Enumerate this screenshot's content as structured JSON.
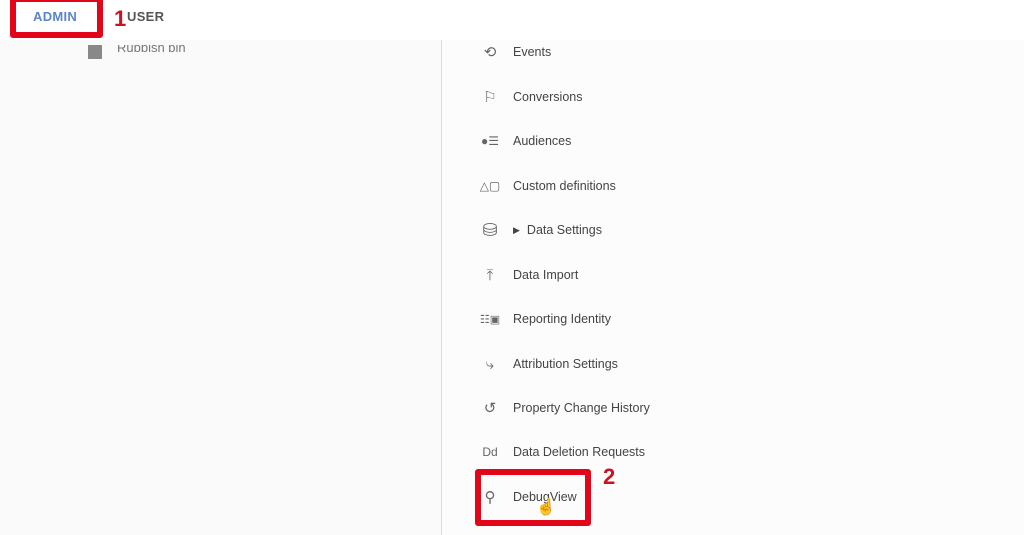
{
  "tabs": [
    {
      "label": "ADMIN",
      "active": true
    },
    {
      "label": "USER",
      "active": false
    }
  ],
  "left_panel": {
    "items": [
      {
        "label": "Rubbish bin",
        "icon": "trash-icon"
      }
    ]
  },
  "property_menu": [
    {
      "label": "Events",
      "icon": "events-icon"
    },
    {
      "label": "Conversions",
      "icon": "flag-icon"
    },
    {
      "label": "Audiences",
      "icon": "audiences-icon"
    },
    {
      "label": "Custom definitions",
      "icon": "shapes-icon"
    },
    {
      "label": "Data Settings",
      "icon": "database-icon",
      "expandable": true
    },
    {
      "label": "Data Import",
      "icon": "upload-icon"
    },
    {
      "label": "Reporting Identity",
      "icon": "identity-icon"
    },
    {
      "label": "Attribution Settings",
      "icon": "attribution-icon"
    },
    {
      "label": "Property Change History",
      "icon": "history-icon"
    },
    {
      "label": "Data Deletion Requests",
      "icon": "dd-icon",
      "icon_text": "Dd"
    },
    {
      "label": "DebugView",
      "icon": "debug-icon"
    }
  ],
  "annotations": [
    {
      "label": "1"
    },
    {
      "label": "2"
    }
  ],
  "colors": {
    "highlight": "#e3061b",
    "admin_tab": "#5b85c9"
  }
}
